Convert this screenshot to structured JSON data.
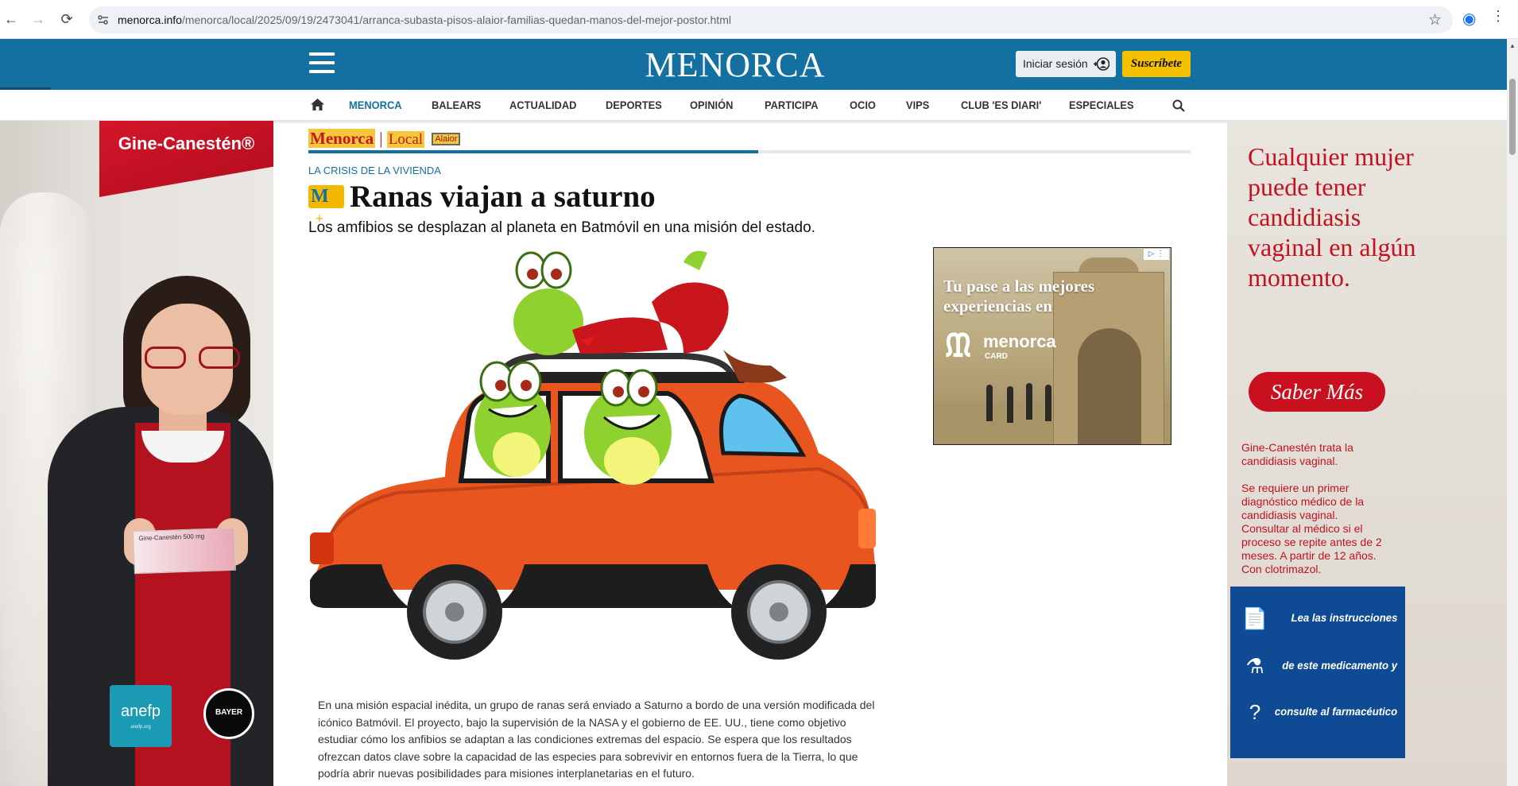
{
  "browser": {
    "url_domain": "menorca.info",
    "url_path": "/menorca/local/2025/09/19/2473041/arranca-subasta-pisos-alaior-familias-quedan-manos-del-mejor-postor.html",
    "back_icon": "←",
    "forward_icon": "→",
    "reload_icon": "⟳",
    "star_icon": "☆",
    "profile_icon": "◉"
  },
  "header": {
    "logo": "MENORCA",
    "login_label": "Iniciar sesión",
    "subscribe_label": "Suscríbete"
  },
  "nav": {
    "items": [
      "MENORCA",
      "BALEARS",
      "ACTUALIDAD",
      "DEPORTES",
      "OPINIÓN",
      "PARTICIPA",
      "OCIO",
      "VIPS",
      "CLUB 'ES DIARI'",
      "ESPECIALES"
    ],
    "active_index": 0
  },
  "breadcrumb": {
    "section": "Menorca",
    "separator": "|",
    "subsection": "Local",
    "tag": "Alaior"
  },
  "reading_progress": 0.51,
  "article": {
    "kicker": "LA CRISIS DE LA VIVIENDA",
    "premium_badge": "M",
    "headline": "Ranas viajan a saturno",
    "subheadline": "Los amfibios se desplazan al planeta en Batmóvil en una misión del estado.",
    "body": "En una misión espacial inédita, un grupo de ranas será enviado a Saturno a bordo de una versión modificada del icónico Batmóvil. El proyecto, bajo la supervisión de la NASA y el gobierno de EE. UU., tiene como objetivo estudiar cómo los anfibios se adaptan a las condiciones extremas del espacio. Se espera que los resultados ofrezcan datos clave sobre la capacidad de las especies para sobrevivir en entornos fuera de la Tierra, lo que podría abrir nuevas posibilidades para misiones interplanetarias en el futuro."
  },
  "inline_ad": {
    "headline": "Tu pase a las mejores experiencias en",
    "logo_name": "menorca",
    "logo_sub": "CARD",
    "choices": "▷ ⋮"
  },
  "left_ad": {
    "brand": "Gine-Canestén®",
    "product_label": "Gine-Canestén 500 mg",
    "anefp": "anefp",
    "anefp_sub": "anefp.org",
    "bayer": "BAYER"
  },
  "right_ad": {
    "headline": "Cualquier mujer puede tener candidiasis vaginal en algún momento.",
    "cta": "Saber Más",
    "disclaimer_1": "Gine-Canestén trata la candidiasis vaginal.",
    "disclaimer_2": "Se requiere un primer diagnóstico médico de la candidiasis vaginal. Consultar al médico si el proceso se repite antes de 2 meses. A partir de 12 años. Con clotrimazol.",
    "warnings": [
      "Lea las instrucciones",
      "de este medicamento y",
      "consulte al farmacéutico"
    ]
  },
  "colors": {
    "brand_blue": "#1470a0",
    "accent_yellow": "#f5c000",
    "ad_red": "#c2121f"
  }
}
